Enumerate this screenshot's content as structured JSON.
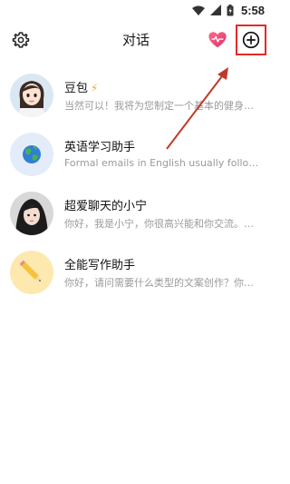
{
  "status_bar": {
    "time": "5:58",
    "icons": [
      "wifi-icon",
      "signal-icon",
      "battery-icon"
    ]
  },
  "header": {
    "title": "对话",
    "left_icon": "settings-gear-icon",
    "heart_icon": "heart-icon",
    "new_chat_icon": "plus-circle-icon"
  },
  "chats": [
    {
      "name": "豆包",
      "badge_icon": "lightning-icon",
      "preview": "当然可以！我将为您制定一个基本的健身计划……",
      "avatar": "cartoon-girl-avatar"
    },
    {
      "name": "英语学习助手",
      "preview": "Formal emails in English usually follow a certain structure",
      "avatar": "globe-avatar"
    },
    {
      "name": "超爱聊天的小宁",
      "preview": "你好，我是小宁，你很高兴能和你交流。你可以和我聊天",
      "avatar": "girl-photo-avatar"
    },
    {
      "name": "全能写作助手",
      "preview": "你好，请问需要什么类型的文案创作？你可以告诉我",
      "avatar": "pencil-avatar"
    }
  ],
  "colors": {
    "highlight_box": "#e02a25",
    "arrow": "#c0392b",
    "bolt": "#f5a623"
  }
}
